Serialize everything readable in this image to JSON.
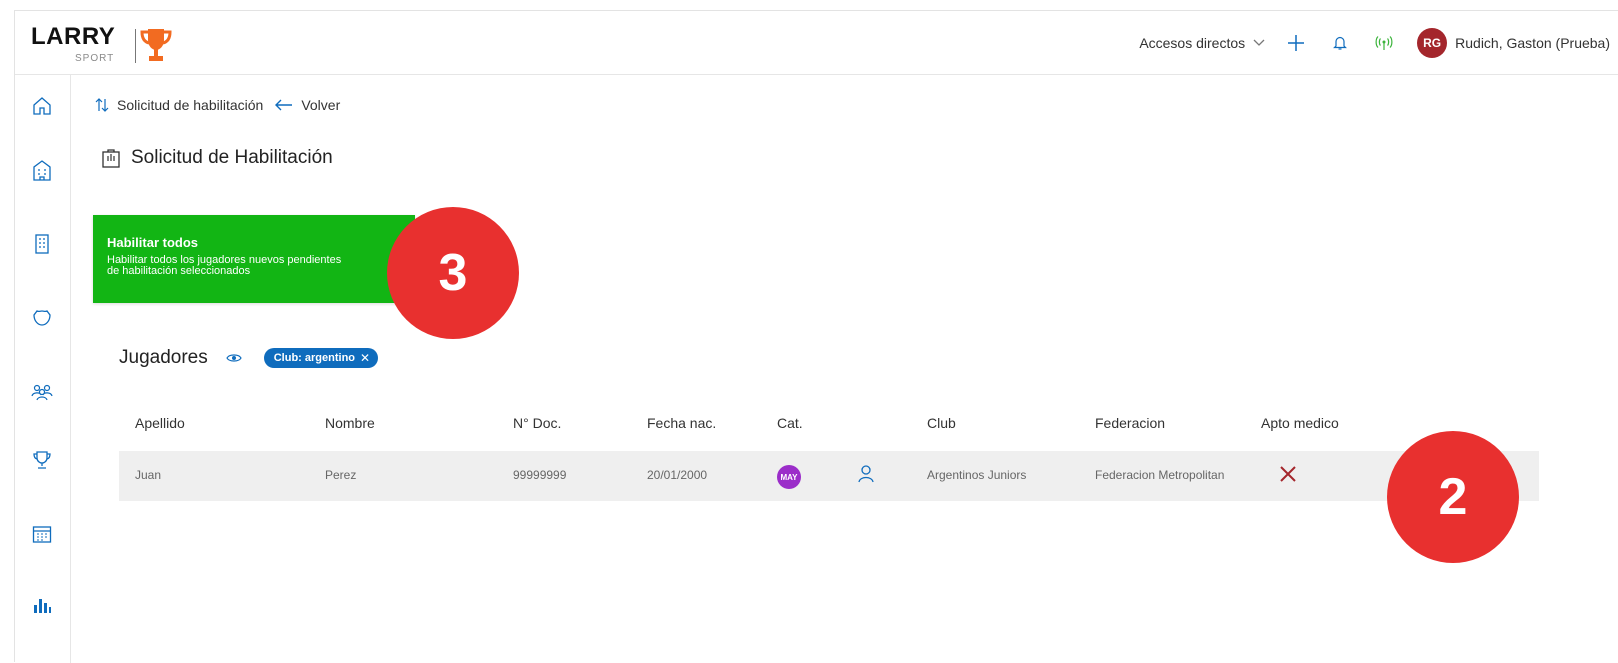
{
  "brand": {
    "name": "LARRY",
    "sub": "SPORT"
  },
  "header": {
    "shortcuts_label": "Accesos directos",
    "user_initials": "RG",
    "user_name": "Rudich, Gaston (Prueba)",
    "avatar_color": "#a4262c"
  },
  "sidebar": {
    "items": [
      {
        "icon": "home-icon"
      },
      {
        "icon": "building-icon"
      },
      {
        "icon": "office-icon"
      },
      {
        "icon": "shield-icon"
      },
      {
        "icon": "people-icon"
      },
      {
        "icon": "trophy-icon"
      },
      {
        "icon": "calendar-icon"
      },
      {
        "icon": "bar-chart-icon"
      }
    ]
  },
  "breadcrumb": {
    "current": "Solicitud de habilitación",
    "back_label": "Volver"
  },
  "page": {
    "title": "Solicitud de Habilitación"
  },
  "action_card": {
    "title": "Habilitar todos",
    "description": "Habilitar todos los jugadores nuevos pendientes de habilitación seleccionados",
    "color": "#12b514"
  },
  "markers": {
    "three": "3",
    "two": "2",
    "color": "#e8302f"
  },
  "players": {
    "title": "Jugadores",
    "filter_chip": "Club: argentino",
    "columns": {
      "apellido": "Apellido",
      "nombre": "Nombre",
      "doc": "N° Doc.",
      "fecha": "Fecha nac.",
      "cat": "Cat.",
      "club": "Club",
      "federacion": "Federacion",
      "apto": "Apto medico"
    },
    "rows": [
      {
        "apellido": "Juan",
        "nombre": "Perez",
        "doc": "99999999",
        "fecha": "20/01/2000",
        "cat": "MAY",
        "club": "Argentinos Juniors",
        "federacion": "Federacion Metropolitan",
        "apto_icon": "x-mark-icon"
      }
    ]
  }
}
